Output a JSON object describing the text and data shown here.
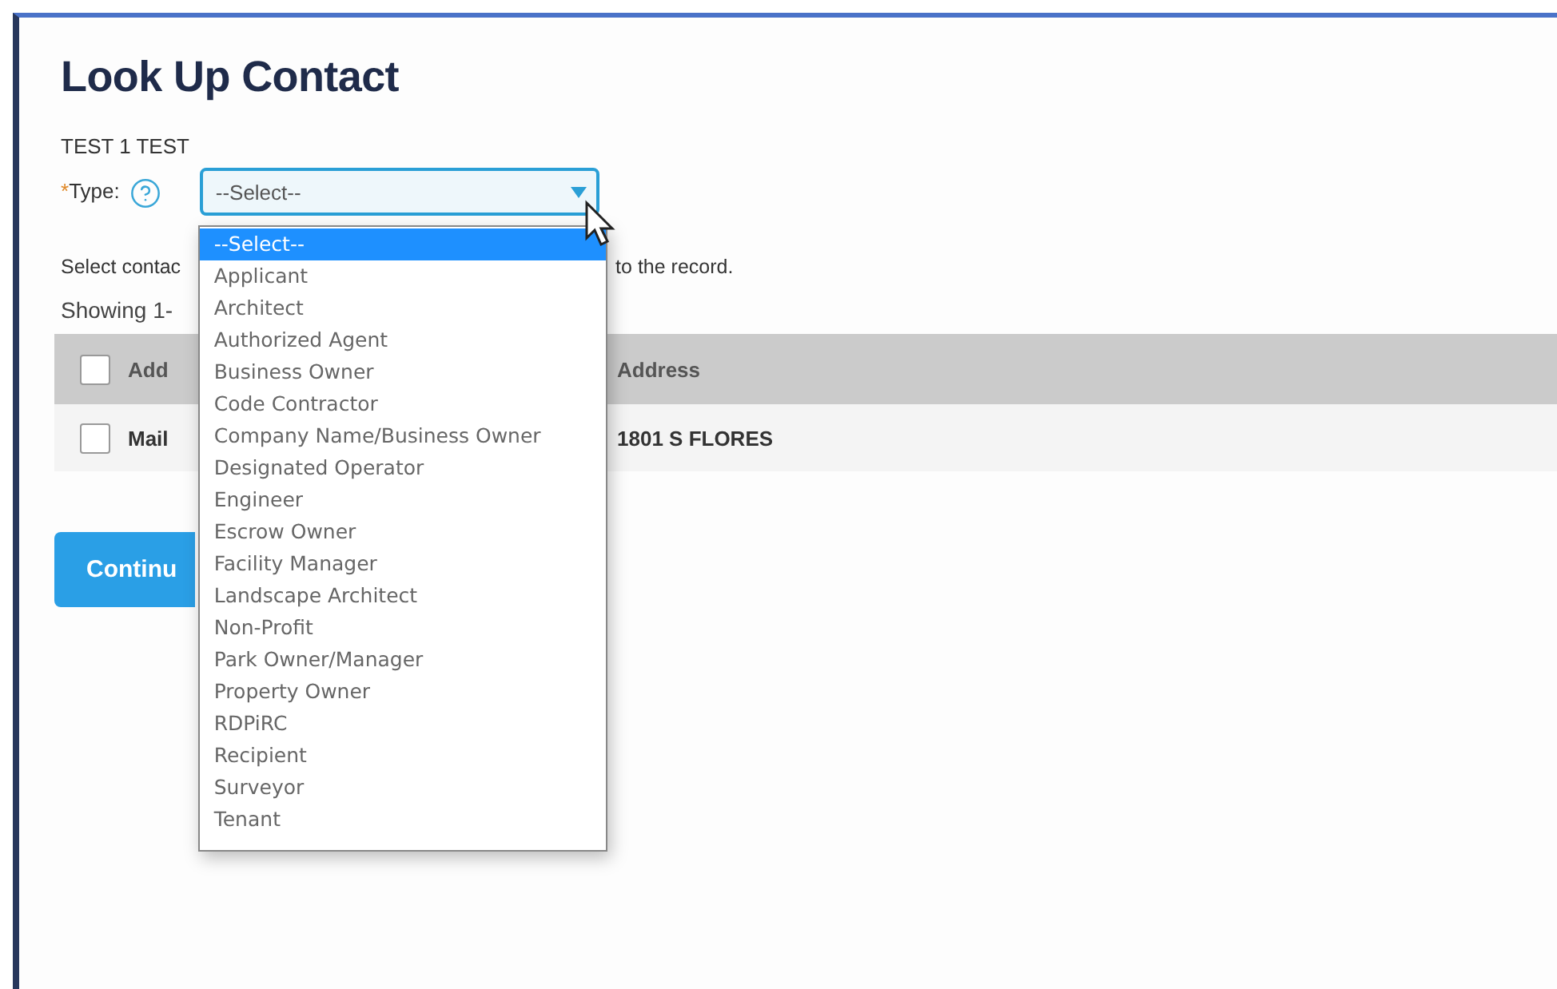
{
  "title": "Look Up Contact",
  "contact_name": "TEST 1 TEST",
  "type_field": {
    "required_mark": "*",
    "label": "Type:",
    "value": "--Select--",
    "expanded": true,
    "options": [
      {
        "label": "--Select--",
        "selected": true
      },
      {
        "label": "Applicant",
        "selected": false
      },
      {
        "label": "Architect",
        "selected": false
      },
      {
        "label": "Authorized Agent",
        "selected": false
      },
      {
        "label": "Business Owner",
        "selected": false
      },
      {
        "label": "Code Contractor",
        "selected": false
      },
      {
        "label": "Company Name/Business Owner",
        "selected": false
      },
      {
        "label": "Designated Operator",
        "selected": false
      },
      {
        "label": "Engineer",
        "selected": false
      },
      {
        "label": "Escrow Owner",
        "selected": false
      },
      {
        "label": "Facility Manager",
        "selected": false
      },
      {
        "label": "Landscape Architect",
        "selected": false
      },
      {
        "label": "Non-Profit",
        "selected": false
      },
      {
        "label": "Park Owner/Manager",
        "selected": false
      },
      {
        "label": "Property Owner",
        "selected": false
      },
      {
        "label": "RDPiRC",
        "selected": false
      },
      {
        "label": "Recipient",
        "selected": false
      },
      {
        "label": "Surveyor",
        "selected": false
      },
      {
        "label": "Tenant",
        "selected": false
      }
    ]
  },
  "instruction": {
    "start": "Select contac",
    "end": "to the record."
  },
  "showing": "Showing 1-",
  "table": {
    "columns": [
      {
        "label": "Add"
      },
      {
        "label": "Address"
      }
    ],
    "header_checked": false,
    "rows": [
      {
        "checked": false,
        "cells": [
          "Mail",
          "1801 S FLORES"
        ]
      }
    ]
  },
  "continue_button": "Continu"
}
